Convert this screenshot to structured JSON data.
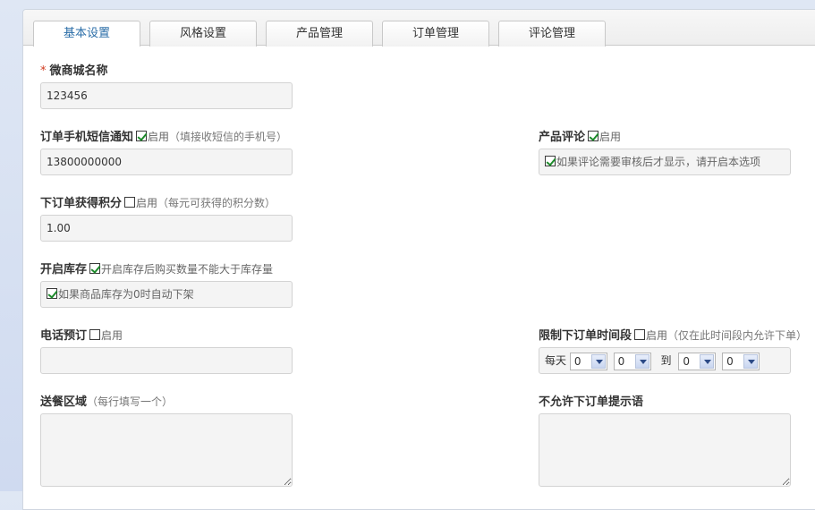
{
  "tabs": [
    {
      "label": "基本设置",
      "active": true
    },
    {
      "label": "风格设置"
    },
    {
      "label": "产品管理"
    },
    {
      "label": "订单管理"
    },
    {
      "label": "评论管理"
    }
  ],
  "shop_name": {
    "required_mark": "*",
    "label": "微商城名称",
    "value": "123456"
  },
  "sms_notify": {
    "label": "订单手机短信通知",
    "enable_text": "启用",
    "note": "（填接收短信的手机号）",
    "value": "13800000000",
    "checked": true
  },
  "points": {
    "label": "下订单获得积分",
    "enable_text": "启用",
    "note": "（每元可获得的积分数）",
    "value": "1.00",
    "checked": false
  },
  "stock": {
    "label": "开启库存",
    "option_text": "开启库存后购买数量不能大于库存量",
    "checked": true,
    "sub_option": "如果商品库存为0时自动下架",
    "sub_checked": true
  },
  "phone_order": {
    "label": "电话预订",
    "enable_text": "启用",
    "checked": false,
    "value": ""
  },
  "delivery": {
    "label": "送餐区域",
    "note": "（每行填写一个）",
    "value": ""
  },
  "review": {
    "label": "产品评论",
    "enable_text": "启用",
    "checked": true,
    "sub_option": "如果评论需要审核后才显示，请开启本选项",
    "sub_checked": true
  },
  "time_limit": {
    "label": "限制下订单时间段",
    "enable_text": "启用",
    "note": "（仅在此时间段内允许下单）",
    "checked": false,
    "every_day": "每天",
    "to": "到",
    "h1": "0",
    "m1": "0",
    "h2": "0",
    "m2": "0"
  },
  "disallow_msg": {
    "label": "不允许下订单提示语",
    "value": ""
  },
  "colors": {
    "accent": "#2b6ea8",
    "required": "#d0391e",
    "check": "#1c8a2a"
  }
}
